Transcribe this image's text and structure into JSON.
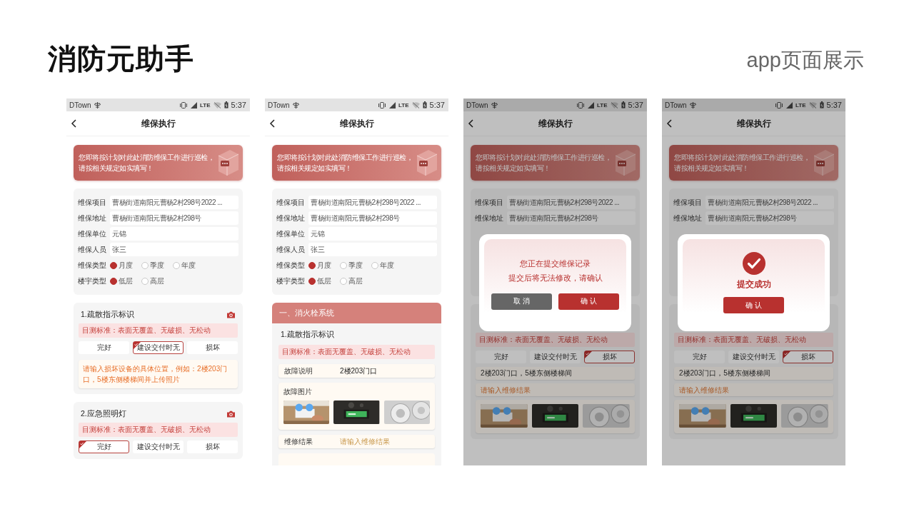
{
  "slide": {
    "title": "消防元助手",
    "subtitle": "app页面展示"
  },
  "phones": [
    {
      "status_bar": {
        "carrier": "DTown",
        "network": "LTE",
        "time": "5:37"
      },
      "nav": {
        "title": "维保执行"
      },
      "banner": {
        "lines": [
          "您即将按计划对此处消防维保工作进行巡检，",
          "请按相关规定如实填写！"
        ]
      },
      "blocks": [
        {
          "kind": "form",
          "rows": [
            {
              "kind": "field",
              "label": "维保项目",
              "value": "曹杨街道南阳元曹杨2村298号2022 ..."
            },
            {
              "kind": "field",
              "label": "维保地址",
              "value": "曹杨街道南阳元曹杨2村298号"
            },
            {
              "kind": "field",
              "label": "维保单位",
              "value": "元锦"
            },
            {
              "kind": "field",
              "label": "维保人员",
              "value": "张三"
            },
            {
              "kind": "radio",
              "label": "维保类型",
              "options": [
                {
                  "label": "月度",
                  "selected": true
                },
                {
                  "label": "季度",
                  "selected": false
                },
                {
                  "label": "年度",
                  "selected": false
                }
              ]
            },
            {
              "kind": "radio",
              "label": "楼宇类型",
              "options": [
                {
                  "label": "低层",
                  "selected": true
                },
                {
                  "label": "高层",
                  "selected": false
                }
              ]
            }
          ]
        },
        {
          "kind": "item",
          "parts": [
            {
              "kind": "title",
              "text": "1.疏散指示标识",
              "camera": true
            },
            {
              "kind": "standard",
              "text": "目测标准：表面无覆盖、无破损、无松动"
            },
            {
              "kind": "options",
              "options": [
                {
                  "label": "完好",
                  "selected": false
                },
                {
                  "label": "建设交付时无",
                  "selected": true
                },
                {
                  "label": "损坏",
                  "selected": false
                }
              ]
            },
            {
              "kind": "textarea",
              "placeholder": "请输入损坏设备的具体位置，例如：2楼203门口，5楼东侧楼梯间并上传照片"
            }
          ]
        },
        {
          "kind": "item",
          "parts": [
            {
              "kind": "title",
              "text": "2.应急照明灯",
              "camera": true
            },
            {
              "kind": "standard",
              "text": "目测标准：表面无覆盖、无破损、无松动"
            },
            {
              "kind": "options",
              "options": [
                {
                  "label": "完好",
                  "selected": true
                },
                {
                  "label": "建设交付时无",
                  "selected": false
                },
                {
                  "label": "损坏",
                  "selected": false
                }
              ]
            }
          ]
        }
      ]
    },
    {
      "status_bar": {
        "carrier": "DTown",
        "network": "LTE",
        "time": "5:37"
      },
      "nav": {
        "title": "维保执行"
      },
      "banner": {
        "lines": [
          "您即将按计划对此处消防维保工作进行巡检，",
          "请按相关规定如实填写！"
        ]
      },
      "blocks": [
        {
          "kind": "form",
          "rows": [
            {
              "kind": "field",
              "label": "维保项目",
              "value": "曹杨街道南阳元曹杨2村298号2022 ..."
            },
            {
              "kind": "field",
              "label": "维保地址",
              "value": "曹杨街道南阳元曹杨2村298号"
            },
            {
              "kind": "field",
              "label": "维保单位",
              "value": "元锦"
            },
            {
              "kind": "field",
              "label": "维保人员",
              "value": "张三"
            },
            {
              "kind": "radio",
              "label": "维保类型",
              "options": [
                {
                  "label": "月度",
                  "selected": true
                },
                {
                  "label": "季度",
                  "selected": false
                },
                {
                  "label": "年度",
                  "selected": false
                }
              ]
            },
            {
              "kind": "radio",
              "label": "楼宇类型",
              "options": [
                {
                  "label": "低层",
                  "selected": true
                },
                {
                  "label": "高层",
                  "selected": false
                }
              ]
            }
          ]
        },
        {
          "kind": "section",
          "heading": "一、消火栓系统",
          "parts": [
            {
              "kind": "title",
              "text": "1.疏散指示标识",
              "camera": false
            },
            {
              "kind": "standard",
              "text": "目测标准：表面无覆盖、无破损、无松动"
            },
            {
              "kind": "pair",
              "label": "故障说明",
              "value": "2楼203门口"
            },
            {
              "kind": "photos",
              "label": "故障图片"
            },
            {
              "kind": "pair",
              "label": "维修结果",
              "placeholder": "请输入维修结果"
            },
            {
              "kind": "blank"
            }
          ]
        }
      ]
    },
    {
      "status_bar": {
        "carrier": "DTown",
        "network": "LTE",
        "time": "5:37"
      },
      "nav": {
        "title": "维保执行"
      },
      "banner": {
        "lines": [
          "您即将按计划对此处消防维保工作进行巡检，",
          "请按相关规定如实填写！"
        ]
      },
      "blocks": [
        {
          "kind": "form",
          "rows": [
            {
              "kind": "field",
              "label": "维保项目",
              "value": "曹杨街道南阳元曹杨2村298号2022 ..."
            },
            {
              "kind": "field",
              "label": "维保地址",
              "value": "曹杨街道南阳元曹杨2村298号"
            }
          ]
        },
        {
          "kind": "item",
          "parts": [
            {
              "kind": "standard",
              "text": "目测标准：表面无覆盖、无破损、无松动"
            },
            {
              "kind": "options",
              "options": [
                {
                  "label": "完好",
                  "selected": false
                },
                {
                  "label": "建设交付时无",
                  "selected": false
                },
                {
                  "label": "损坏",
                  "selected": true
                }
              ]
            },
            {
              "kind": "note",
              "value": "2楼203门口，5楼东侧楼梯间"
            },
            {
              "kind": "input",
              "placeholder": "请输入维修结果"
            },
            {
              "kind": "photos"
            }
          ]
        }
      ],
      "dialog": {
        "kind": "confirm",
        "lines": [
          "您正在提交维保记录",
          "提交后将无法修改，请确认"
        ],
        "buttons": [
          {
            "kind": "cancel",
            "label": "取 消"
          },
          {
            "kind": "primary",
            "label": "确 认"
          }
        ]
      }
    },
    {
      "status_bar": {
        "carrier": "DTown",
        "network": "LTE",
        "time": "5:37"
      },
      "nav": {
        "title": "维保执行"
      },
      "banner": {
        "lines": [
          "您即将按计划对此处消防维保工作进行巡检，",
          "请按相关规定如实填写！"
        ]
      },
      "blocks": [
        {
          "kind": "form",
          "rows": [
            {
              "kind": "field",
              "label": "维保项目",
              "value": "曹杨街道南阳元曹杨2村298号2022 ..."
            },
            {
              "kind": "field",
              "label": "维保地址",
              "value": "曹杨街道南阳元曹杨2村298号"
            }
          ]
        },
        {
          "kind": "item",
          "parts": [
            {
              "kind": "standard",
              "text": "目测标准：表面无覆盖、无破损、无松动"
            },
            {
              "kind": "options",
              "options": [
                {
                  "label": "完好",
                  "selected": false
                },
                {
                  "label": "建设交付时无",
                  "selected": false
                },
                {
                  "label": "损坏",
                  "selected": true
                }
              ]
            },
            {
              "kind": "note",
              "value": "2楼203门口，5楼东侧楼梯间"
            },
            {
              "kind": "input",
              "placeholder": "请输入维修结果"
            },
            {
              "kind": "photos"
            }
          ]
        }
      ],
      "dialog": {
        "kind": "success",
        "message": "提交成功",
        "buttons": [
          {
            "kind": "primary",
            "label": "确 认"
          }
        ]
      }
    }
  ]
}
